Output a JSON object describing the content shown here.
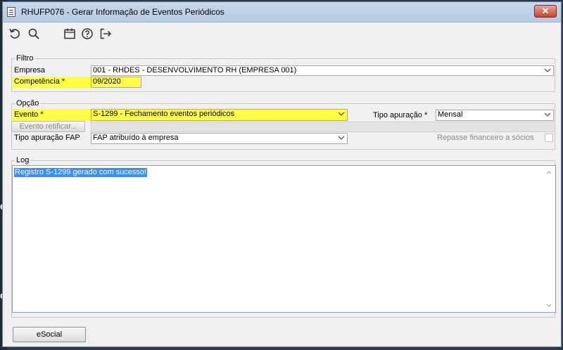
{
  "window": {
    "title": "RHUFP076 - Gerar Informação de Eventos Periódicos",
    "close_label": "✕"
  },
  "toolbar": {
    "icons": [
      "refresh-icon",
      "search-icon",
      "calendar-icon",
      "help-icon",
      "exit-icon"
    ]
  },
  "filtro": {
    "legend": "Filtro",
    "empresa_label": "Empresa",
    "empresa_value": "001 - RHDES - DESENVOLVIMENTO RH (EMPRESA 001)",
    "competencia_label": "Competência *",
    "competencia_value": "09/2020"
  },
  "opcao": {
    "legend": "Opção",
    "evento_label": "Evento *",
    "evento_value": "S-1299 - Fechamento eventos periódicos",
    "tipo_apuracao_label": "Tipo apuração *",
    "tipo_apuracao_value": "Mensal",
    "evento_retificar_label": "Evento retificar...",
    "tipo_apuracao_fap_label": "Tipo apuração FAP",
    "tipo_apuracao_fap_value": "FAP atribuído à empresa",
    "repasse_label": "Repasse financeiro a sócios"
  },
  "log": {
    "legend": "Log",
    "text": "Registro S-1299 gerado com sucesso!"
  },
  "footer": {
    "esocial_label": "eSocial"
  },
  "colors": {
    "highlight": "#ffff40",
    "selection": "#3390ff",
    "close_button": "#c7462f"
  }
}
